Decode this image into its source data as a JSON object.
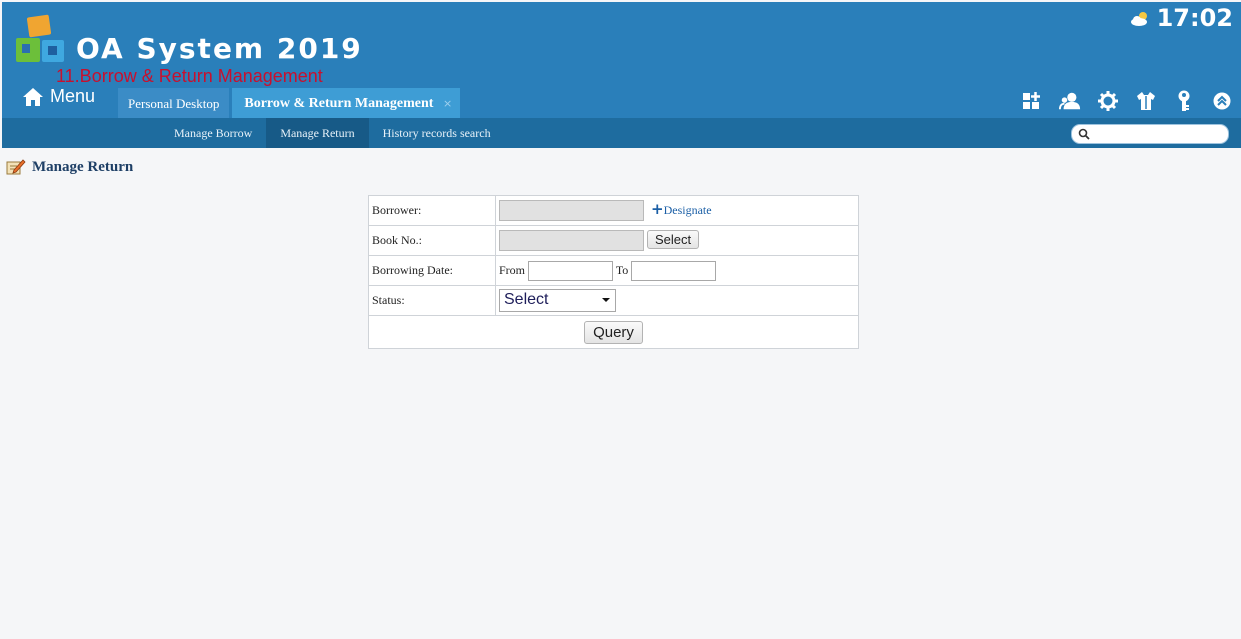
{
  "header": {
    "app_title": "OA System 2019",
    "module_title": "11.Borrow & Return Management",
    "clock": "17:02",
    "menu_label": "Menu"
  },
  "tabs": [
    {
      "label": "Personal Desktop",
      "active": false
    },
    {
      "label": "Borrow & Return Management",
      "active": true,
      "close": "×"
    }
  ],
  "toolbar_icons": [
    "grid-add-icon",
    "user-group-icon",
    "gear-icon",
    "shirt-icon",
    "key-icon",
    "collapse-up-icon"
  ],
  "subnav": {
    "items": [
      "Manage Borrow",
      "Manage Return",
      "History records search"
    ],
    "active": "Manage Return"
  },
  "page": {
    "heading": "Manage Return"
  },
  "form": {
    "borrower_label": "Borrower:",
    "designate_label": "Designate",
    "book_no_label": "Book No.:",
    "select_button": "Select",
    "borrowing_date_label": "Borrowing Date:",
    "from_label": "From",
    "to_label": "To",
    "status_label": "Status:",
    "status_value": "Select",
    "query_button": "Query"
  },
  "colors": {
    "header_bg": "#2a7fba",
    "subnav_bg": "#1e6c9f",
    "module_title": "#c8102e",
    "heading": "#1e3f66"
  }
}
